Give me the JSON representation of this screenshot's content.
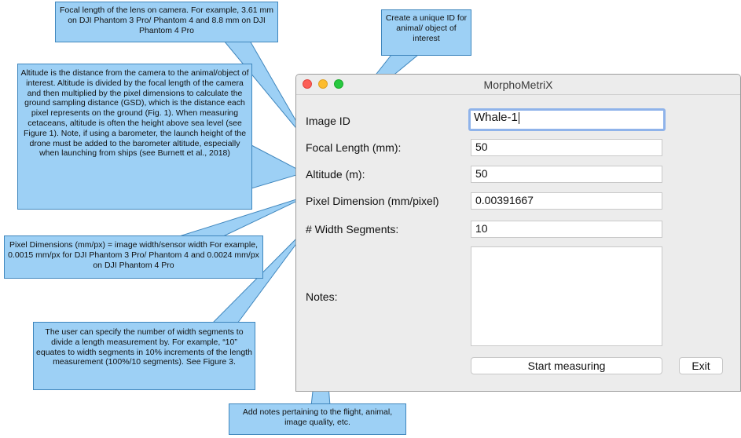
{
  "window": {
    "title": "MorphoMetriX",
    "fields": {
      "image_id": {
        "label": "Image ID",
        "value": "Whale-1"
      },
      "focal_length": {
        "label": "Focal Length (mm):",
        "value": "50"
      },
      "altitude": {
        "label": "Altitude (m):",
        "value": "50"
      },
      "pixel_dimension": {
        "label": "Pixel Dimension (mm/pixel)",
        "value": "0.00391667"
      },
      "width_segments": {
        "label": "# Width Segments:",
        "value": "10"
      },
      "notes": {
        "label": "Notes:",
        "value": ""
      }
    },
    "start_button": "Start measuring",
    "exit_button": "Exit"
  },
  "callouts": {
    "focal_length": "Focal length of the lens on camera. For example, 3.61 mm on DJI Phantom 3 Pro/ Phantom 4 and 8.8 mm on DJI Phantom 4 Pro",
    "image_id": "Create a unique ID for animal/ object of interest",
    "altitude": "Altitude is the distance from the camera to the animal/object of interest. Altitude is divided by the focal length of the camera and then multiplied by the pixel dimensions to calculate the ground sampling distance (GSD), which is the distance each pixel represents on the ground (Fig. 1). When measuring cetaceans, altitude is often the height above sea level (see Figure 1). Note, if using a barometer, the launch height of the drone must be added to the barometer altitude, especially when launching from ships (see Burnett et al., 2018)",
    "pixel_dimension": "Pixel Dimensions (mm/px) = image width/sensor width For example, 0.0015 mm/px for DJI Phantom 3 Pro/ Phantom 4 and 0.0024 mm/px on DJI Phantom 4 Pro",
    "width_segments": "The user can specify the number of width segments to divide a length measurement by. For example, “10” equates to width segments in 10% increments of the length measurement (100%/10 segments). See Figure 3.",
    "notes": "Add notes pertaining to the flight, animal, image quality, etc."
  },
  "colors": {
    "callout_fill": "#9dd0f5",
    "callout_border": "#3f86bd",
    "focus_ring": "#8fb3ea"
  }
}
